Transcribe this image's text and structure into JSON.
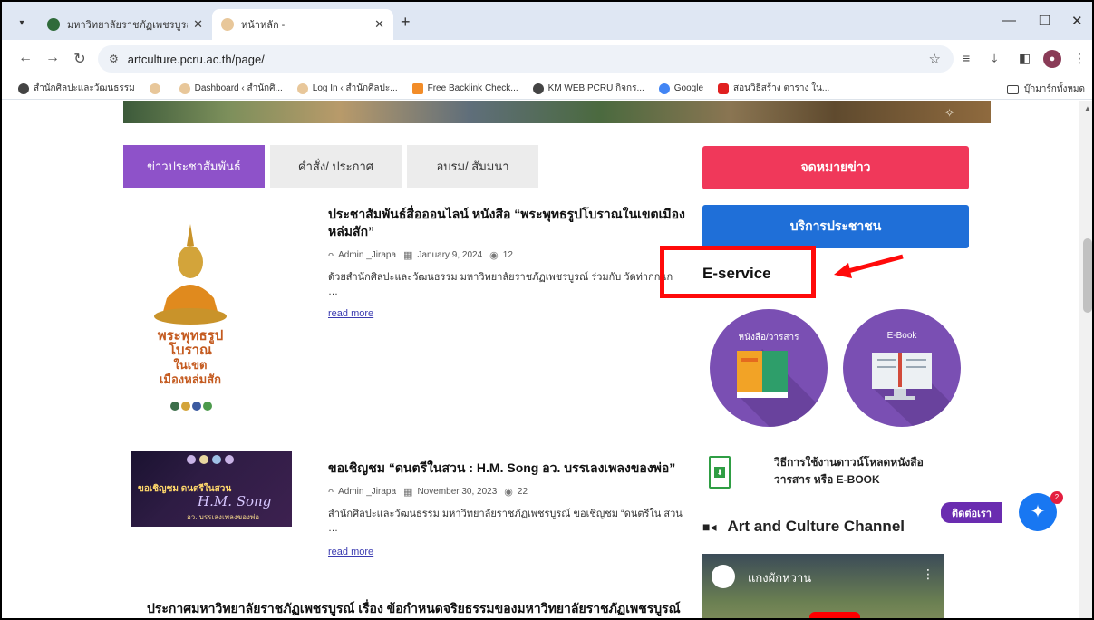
{
  "browser": {
    "tabs": [
      {
        "title": "มหาวิทยาลัยราชภัฏเพชรบูรณ์",
        "active": false
      },
      {
        "title": "หน้าหลัก -",
        "active": true
      }
    ],
    "url": "artculture.pcru.ac.th/page/",
    "bookmarks": [
      "สำนักศิลปะและวัฒนธรรม",
      "Dashboard ‹ สำนักศิ...",
      "Log In ‹ สำนักศิลปะ...",
      "Free Backlink Check...",
      "KM WEB PCRU กิจกร...",
      "Google",
      "สอนวิธีสร้าง ตาราง ใน..."
    ],
    "all_bookmarks": "บุ๊กมาร์กทั้งหมด"
  },
  "page": {
    "tabs": [
      "ข่าวประชาสัมพันธ์",
      "คำสั่ง/ ประกาศ",
      "อบรม/ สัมมนา"
    ],
    "posts": [
      {
        "title": "ประชาสัมพันธ์สื่อออนไลน์ หนังสือ “พระพุทธรูปโบราณในเขตเมืองหล่มสัก”",
        "author": "Admin _Jirapa",
        "date": "January 9, 2024",
        "views": "12",
        "excerpt": "ด้วยสำนักศิลปะและวัฒนธรรม มหาวิทยาลัยราชภัฏเพชรบูรณ์ ร่วมกับ วัดท่ากกแก",
        "ellipsis": "…",
        "read_more": "read more",
        "thumb_text": [
          "พระพุทธรูป",
          "โบราณ",
          "ในเขต",
          "เมืองหล่มสัก"
        ]
      },
      {
        "title": "ขอเชิญชม “ดนตรีในสวน : H.M. Song อว. บรรเลงเพลงของพ่อ”",
        "author": "Admin _Jirapa",
        "date": "November 30, 2023",
        "views": "22",
        "excerpt": "สำนักศิลปะและวัฒนธรรม มหาวิทยาลัยราชภัฏเพชรบูรณ์ ขอเชิญชม “ดนตรีใน สวน …",
        "read_more": "read more",
        "thumb_text": [
          "ขอเชิญชม ดนตรีในสวน",
          "H.M. Song",
          "อว. บรรเลงเพลงของพ่อ"
        ]
      }
    ],
    "bottom_title": "ประกาศมหาวิทยาลัยราชภัฏเพชรบูรณ์ เรื่อง ข้อกำหนดจริยธรรมของมหาวิทยาลัยราชภัฏเพชรบูรณ์"
  },
  "sidebar": {
    "newsletter": "จดหมายข่าว",
    "public_service": "บริการประชาชน",
    "eservice_title": "E-service",
    "circle1": "หนังสือ/วารสาร",
    "circle2": "E-Book",
    "download_line1": "วิธีการใช้งานดาวน์โหลดหนังสือ",
    "download_line2": "วารสาร หรือ E-BOOK",
    "channel_title": "Art and Culture Channel",
    "video_channel": "แกงผักหวาน",
    "contact": "ติดต่อเรา",
    "messenger_badge": "2"
  },
  "colors": {
    "tab_active": "#8e52c9",
    "newsletter": "#f0385a",
    "public_service": "#1f6fd8",
    "circle": "#7a4fb3",
    "highlight": "#ff0a0a"
  }
}
